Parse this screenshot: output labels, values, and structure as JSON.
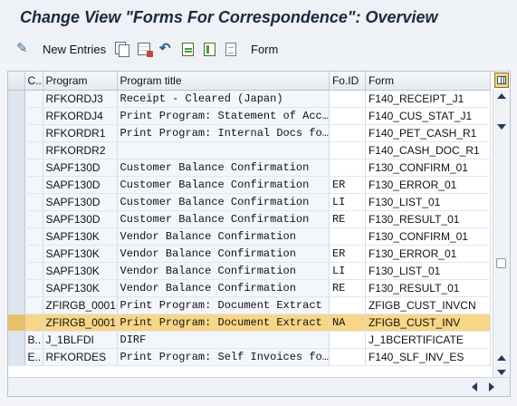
{
  "title": "Change View \"Forms For Correspondence\": Overview",
  "toolbar": {
    "new_entries_label": "New Entries",
    "form_label": "Form",
    "icons": [
      "display-change-icon",
      "copy-icon",
      "delete-icon",
      "undo-icon",
      "select-all-icon",
      "select-block-icon",
      "deselect-all-icon"
    ]
  },
  "table": {
    "headers": {
      "sel": "",
      "c": "C..",
      "program": "Program",
      "program_title": "Program title",
      "foid": "Fo.ID",
      "form": "Form"
    },
    "rows": [
      {
        "c": "",
        "program": "RFKORDJ3",
        "title": "Receipt - Cleared (Japan)",
        "foid": "",
        "form": "F140_RECEIPT_J1"
      },
      {
        "c": "",
        "program": "RFKORDJ4",
        "title": "Print Program: Statement of Acc…",
        "foid": "",
        "form": "F140_CUS_STAT_J1"
      },
      {
        "c": "",
        "program": "RFKORDR1",
        "title": "Print Program: Internal Docs fo…",
        "foid": "",
        "form": "F140_PET_CASH_R1"
      },
      {
        "c": "",
        "program": "RFKORDR2",
        "title": "",
        "foid": "",
        "form": "F140_CASH_DOC_R1"
      },
      {
        "c": "",
        "program": "SAPF130D",
        "title": "Customer Balance Confirmation",
        "foid": "",
        "form": "F130_CONFIRM_01"
      },
      {
        "c": "",
        "program": "SAPF130D",
        "title": "Customer Balance Confirmation",
        "foid": "ER",
        "form": "F130_ERROR_01"
      },
      {
        "c": "",
        "program": "SAPF130D",
        "title": "Customer Balance Confirmation",
        "foid": "LI",
        "form": "F130_LIST_01"
      },
      {
        "c": "",
        "program": "SAPF130D",
        "title": "Customer Balance Confirmation",
        "foid": "RE",
        "form": "F130_RESULT_01"
      },
      {
        "c": "",
        "program": "SAPF130K",
        "title": "Vendor Balance Confirmation",
        "foid": "",
        "form": "F130_CONFIRM_01"
      },
      {
        "c": "",
        "program": "SAPF130K",
        "title": "Vendor Balance Confirmation",
        "foid": "ER",
        "form": "F130_ERROR_01"
      },
      {
        "c": "",
        "program": "SAPF130K",
        "title": "Vendor Balance Confirmation",
        "foid": "LI",
        "form": "F130_LIST_01"
      },
      {
        "c": "",
        "program": "SAPF130K",
        "title": "Vendor Balance Confirmation",
        "foid": "RE",
        "form": "F130_RESULT_01"
      },
      {
        "c": "",
        "program": "ZFIRGB_0001",
        "title": "Print Program: Document Extract",
        "foid": "",
        "form": "ZFIGB_CUST_INVCN"
      },
      {
        "c": "",
        "program": "ZFIRGB_0001",
        "title": "Print Program: Document Extract",
        "foid": "NA",
        "form": "ZFIGB_CUST_INV",
        "highlight": true
      },
      {
        "c": "B..",
        "program": "J_1BLFDI",
        "title": "DIRF",
        "foid": "",
        "form": "J_1BCERTIFICATE"
      },
      {
        "c": "E..",
        "program": "RFKORDES",
        "title": "Print Program: Self Invoices fo…",
        "foid": "",
        "form": "F140_SLF_INV_ES"
      }
    ]
  },
  "colors": {
    "highlight_row": "#f8d686",
    "selector_column": "#dde5ee"
  }
}
